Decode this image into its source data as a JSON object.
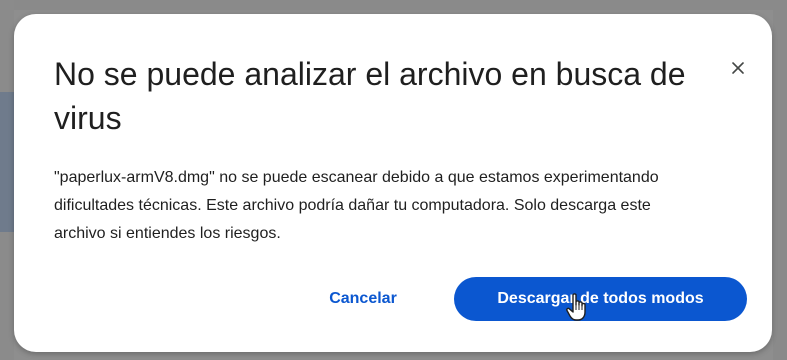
{
  "dialog": {
    "title": "No se puede analizar el archivo en busca de virus",
    "body": "\"paperlux-armV8.dmg\" no se puede escanear debido a que estamos experimentando dificultades técnicas. Este archivo podría dañar tu computadora. Solo descarga este archivo si entiendes los riesgos.",
    "close_icon": "close-icon",
    "actions": {
      "cancel_label": "Cancelar",
      "download_label": "Descargar de todos modos"
    }
  },
  "cursor_icon": "hand-pointer-icon",
  "colors": {
    "accent": "#0b57d0",
    "dialog_background": "#ffffff",
    "backdrop": "#8e8e8e",
    "text": "#1f1f1f"
  }
}
